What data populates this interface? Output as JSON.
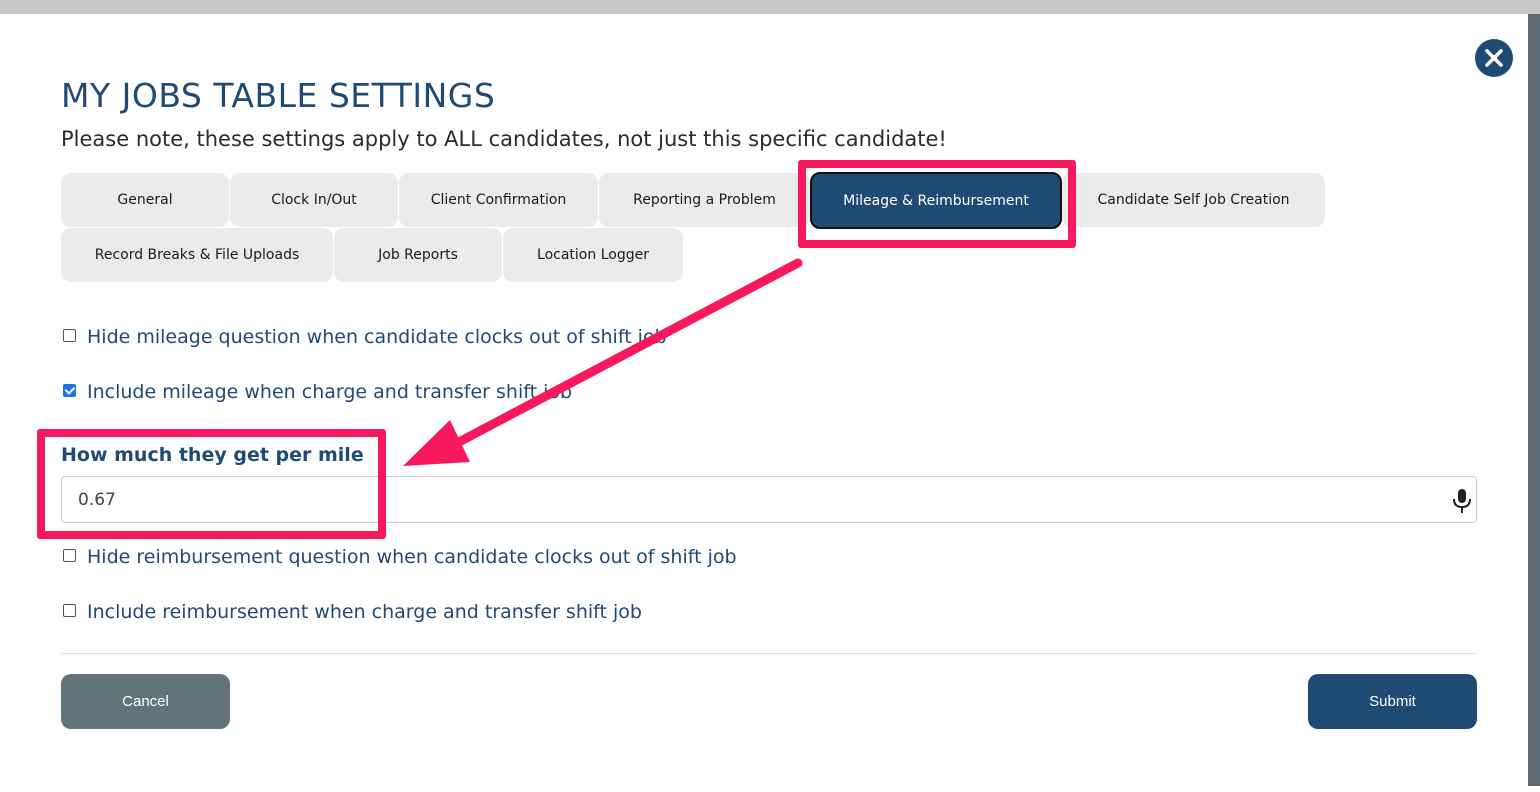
{
  "modal": {
    "title": "MY JOBS TABLE SETTINGS",
    "note": "Please note, these settings apply to ALL candidates, not just this specific candidate!",
    "close_icon": "close-icon"
  },
  "tabs": [
    {
      "label": "General",
      "active": false
    },
    {
      "label": "Clock In/Out",
      "active": false
    },
    {
      "label": "Client Confirmation",
      "active": false
    },
    {
      "label": "Reporting a Problem",
      "active": false
    },
    {
      "label": "Mileage & Reimbursement",
      "active": true
    },
    {
      "label": "Candidate Self Job Creation",
      "active": false
    },
    {
      "label": "Record Breaks & File Uploads",
      "active": false
    },
    {
      "label": "Job Reports",
      "active": false
    },
    {
      "label": "Location Logger",
      "active": false
    }
  ],
  "options": {
    "hide_mileage": {
      "label": "Hide mileage question when candidate clocks out of shift job",
      "checked": false
    },
    "include_mileage": {
      "label": "Include mileage when charge and transfer shift job",
      "checked": true
    },
    "hide_reimbursement": {
      "label": "Hide reimbursement question when candidate clocks out of shift job",
      "checked": false
    },
    "include_reimbursement": {
      "label": "Include reimbursement when charge and transfer shift job",
      "checked": false
    }
  },
  "mileage_rate": {
    "label": "How much they get per mile",
    "value": "0.67",
    "mic_icon": "microphone-icon"
  },
  "buttons": {
    "cancel": "Cancel",
    "submit": "Submit"
  },
  "colors": {
    "primary": "#1f4a73",
    "highlight": "#f7195e",
    "cancel": "#617479"
  }
}
